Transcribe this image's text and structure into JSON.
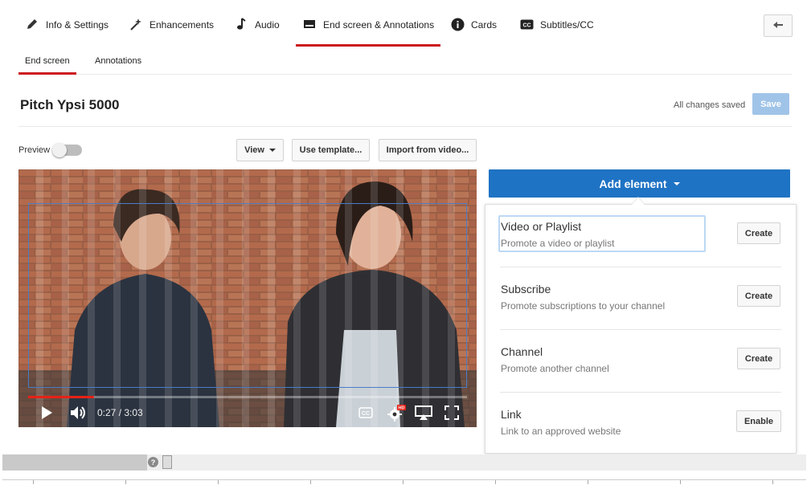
{
  "top_tabs": [
    {
      "label": "Info & Settings",
      "icon": "pencil-icon"
    },
    {
      "label": "Enhancements",
      "icon": "magic-wand-icon"
    },
    {
      "label": "Audio",
      "icon": "music-note-icon"
    },
    {
      "label": "End screen & Annotations",
      "icon": "end-screen-icon",
      "active": true
    },
    {
      "label": "Cards",
      "icon": "info-icon"
    },
    {
      "label": "Subtitles/CC",
      "icon": "cc-icon"
    }
  ],
  "sub_tabs": [
    {
      "label": "End screen",
      "active": true
    },
    {
      "label": "Annotations"
    }
  ],
  "video_title": "Pitch Ypsi 5000",
  "save_status": "All changes saved",
  "save_label": "Save",
  "toolbar": {
    "preview_label": "Preview",
    "view_label": "View",
    "template_label": "Use template...",
    "import_label": "Import from video..."
  },
  "player": {
    "timecode": "0:27 / 3:03",
    "progress_fraction": 0.15,
    "hd_badge": "HD"
  },
  "add_element": {
    "label": "Add element",
    "items": [
      {
        "title": "Video or Playlist",
        "description": "Promote a video or playlist",
        "action": "Create"
      },
      {
        "title": "Subscribe",
        "description": "Promote subscriptions to your channel",
        "action": "Create"
      },
      {
        "title": "Channel",
        "description": "Promote another channel",
        "action": "Create"
      },
      {
        "title": "Link",
        "description": "Link to an approved website",
        "action": "Enable"
      }
    ]
  },
  "timeline": {
    "help_icon_label": "?"
  },
  "colors": {
    "accent_red": "#cc181e",
    "primary_blue": "#1f73c4",
    "save_disabled": "#a0c4e8"
  }
}
